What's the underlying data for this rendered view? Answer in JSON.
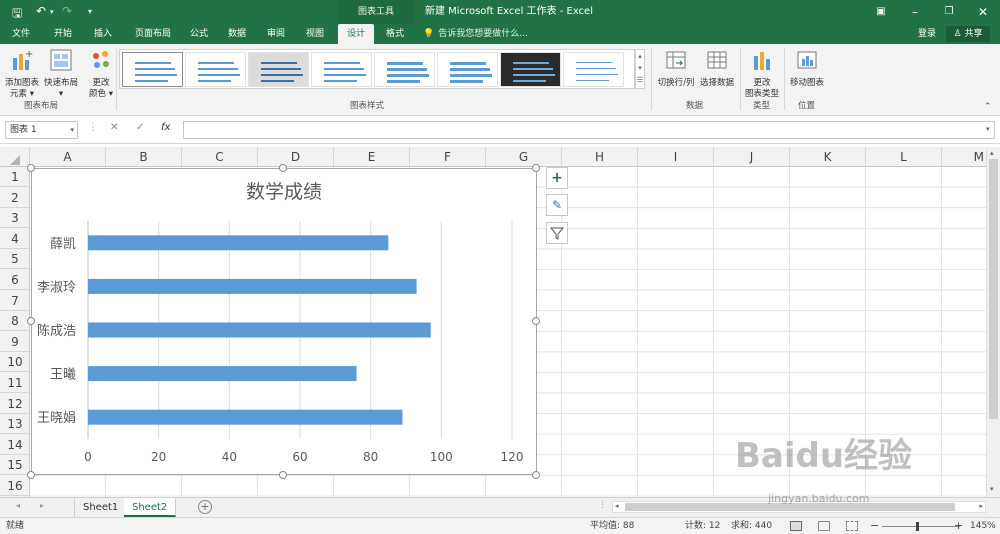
{
  "titlebar": {
    "context_tab": "图表工具",
    "window_title": "新建 Microsoft Excel 工作表 - Excel"
  },
  "tabs": [
    "文件",
    "开始",
    "插入",
    "页面布局",
    "公式",
    "数据",
    "审阅",
    "视图",
    "设计",
    "格式"
  ],
  "active_tab": "设计",
  "tell_me": "告诉我您想要做什么...",
  "login": "登录",
  "share": "共享",
  "ribbon": {
    "add_element": "添加图表元素",
    "add_element_line1": "添加图表",
    "add_element_line2": "元素",
    "quick_layout": "快速布局",
    "change_colors": "更改颜色",
    "change_colors_line1": "更改",
    "change_colors_line2": "颜色",
    "group_layout": "图表布局",
    "group_styles": "图表样式",
    "switch_row_col": "切换行/列",
    "select_data": "选择数据",
    "group_data": "数据",
    "change_type_line1": "更改",
    "change_type_line2": "图表类型",
    "group_type": "类型",
    "move_chart": "移动图表",
    "group_location": "位置"
  },
  "name_box": "图表 1",
  "formula_icons": {
    "cancel": "✕",
    "enter": "✓",
    "fx": "fx"
  },
  "columns": [
    "A",
    "B",
    "C",
    "D",
    "E",
    "F",
    "G",
    "H",
    "I",
    "J",
    "K",
    "L",
    "M"
  ],
  "rows": [
    "1",
    "2",
    "3",
    "4",
    "5",
    "6",
    "7",
    "8",
    "9",
    "10",
    "11",
    "12",
    "13",
    "14",
    "15",
    "16"
  ],
  "chart_data": {
    "type": "bar",
    "orientation": "horizontal",
    "title": "数学成绩",
    "categories": [
      "薛凯",
      "李淑玲",
      "陈成浩",
      "王曦",
      "王晓娟"
    ],
    "values": [
      85,
      93,
      97,
      76,
      89
    ],
    "xlim": [
      0,
      120
    ],
    "xticks": [
      "0",
      "20",
      "40",
      "60",
      "80",
      "100",
      "120"
    ],
    "grid": true,
    "color": "#5b9bd5"
  },
  "sheets": [
    "Sheet1",
    "Sheet2"
  ],
  "active_sheet": "Sheet2",
  "status": {
    "ready": "就绪",
    "average": "平均值: 88",
    "count": "计数: 12",
    "sum": "求和: 440",
    "zoom": "145%"
  },
  "watermark": "Baidu经验",
  "watermark_url": "jingyan.baidu.com",
  "colors": {
    "excel_green": "#217346",
    "bar": "#5b9bd5"
  }
}
